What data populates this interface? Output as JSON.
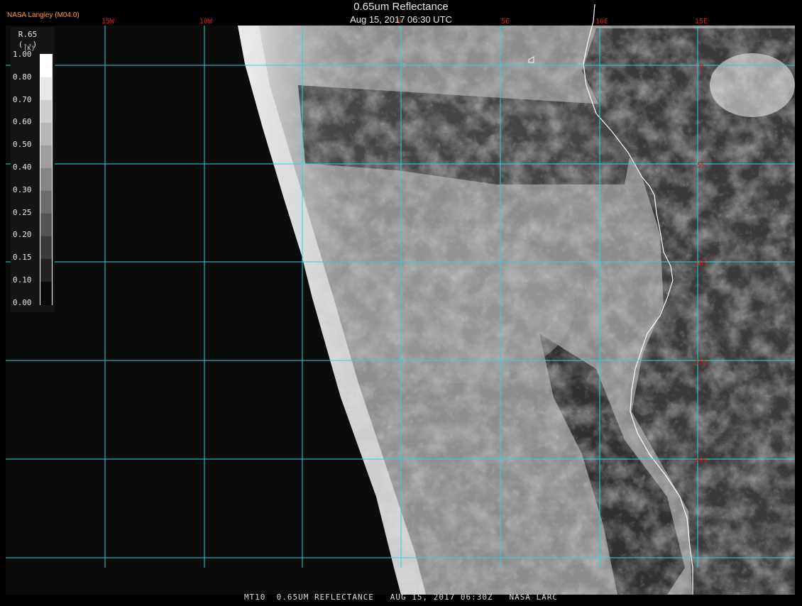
{
  "header": {
    "title": "0.65um Reflectance",
    "subtitle": "Aug 15, 2017 06:30 UTC",
    "org": "NASA Langley (M04.0)"
  },
  "footer": {
    "text": "MT10  0.65UM REFLECTANCE   AUG 15, 2017 06:30Z   NASA LARC"
  },
  "legend": {
    "title": "R.65",
    "units": "(--)",
    "mark": "(K)",
    "ticks": [
      "1.00",
      "0.80",
      "0.70",
      "0.60",
      "0.50",
      "0.40",
      "0.30",
      "0.25",
      "0.20",
      "0.15",
      "0.10",
      "0.00"
    ]
  },
  "grid": {
    "lon_labels": [
      "15W",
      "10W",
      "0",
      "5E",
      "10E",
      "15E"
    ],
    "lat_labels": [
      "0",
      "5S",
      "10S",
      "15S",
      "20S"
    ]
  },
  "colors": {
    "grid": "#27d6d6",
    "coast": "#ffffff",
    "lon_label": "#d81414",
    "lat_label": "#d81414",
    "ocean_space": "#0a0a0a"
  }
}
